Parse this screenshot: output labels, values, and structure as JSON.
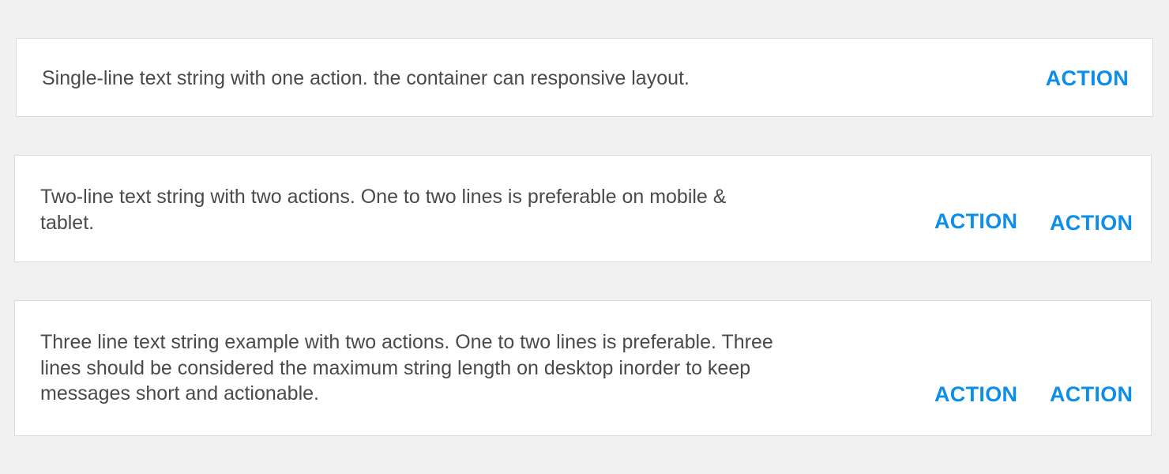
{
  "accent_color": "#0d8ee9",
  "snackbars": [
    {
      "text": "Single-line text string with one action. the container can responsive layout.",
      "actions": [
        "ACTION"
      ]
    },
    {
      "text": "Two-line text string with two actions. One to two lines is preferable on mobile & tablet.",
      "actions": [
        "ACTION",
        "ACTION"
      ]
    },
    {
      "text": "Three line text string example with two actions. One to two lines is preferable. Three lines should be considered the maximum string length on desktop inorder to keep messages short and actionable.",
      "actions": [
        "ACTION",
        "ACTION"
      ]
    }
  ]
}
